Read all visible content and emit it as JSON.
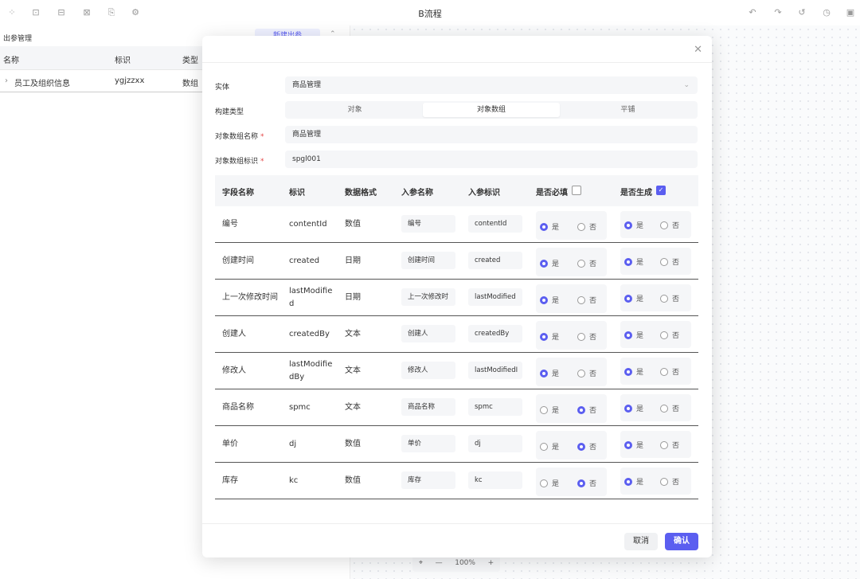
{
  "app": {
    "title": "B流程"
  },
  "toolbar_left_icons": [
    "grid-icon",
    "variable-icon",
    "code-icon",
    "bracket-x-icon",
    "copy-doc-icon",
    "gear-icon"
  ],
  "toolbar_right_icons": [
    "undo-arrow-icon",
    "redo-arrow-icon",
    "rotate-back-icon",
    "history-icon",
    "save-icon"
  ],
  "left_panel": {
    "title": "出参管理",
    "new_button": "新建出参",
    "columns": [
      "名称",
      "标识",
      "类型"
    ],
    "rows": [
      {
        "name": "员工及组织信息",
        "id": "ygjzzxx",
        "type": "数组"
      }
    ]
  },
  "zoom": {
    "minus": "—",
    "value": "100%",
    "plus": "+"
  },
  "modal": {
    "entity_label": "实体",
    "entity_value": "商品管理",
    "build_type_label": "构建类型",
    "build_types": [
      "对象",
      "对象数组",
      "平铺"
    ],
    "active_build_type": "对象数组",
    "array_name_label": "对象数组名称",
    "array_name_value": "商品管理",
    "array_id_label": "对象数组标识",
    "array_id_value": "spgl001",
    "required_mark": "*",
    "table": {
      "headers": [
        "字段名称",
        "标识",
        "数据格式",
        "入参名称",
        "入参标识",
        "是否必填",
        "是否生成"
      ],
      "rows": [
        {
          "field": "编号",
          "id": "contentId",
          "format": "数值",
          "param_name": "编号",
          "param_id": "contentId",
          "required": "是",
          "generate": "是"
        },
        {
          "field": "创建时间",
          "id": "created",
          "format": "日期",
          "param_name": "创建时间",
          "param_id": "created",
          "required": "是",
          "generate": "是"
        },
        {
          "field": "上一次修改时间",
          "id": "lastModified",
          "format": "日期",
          "param_name": "上一次修改时",
          "param_id": "lastModified",
          "required": "是",
          "generate": "是"
        },
        {
          "field": "创建人",
          "id": "createdBy",
          "format": "文本",
          "param_name": "创建人",
          "param_id": "createdBy",
          "required": "是",
          "generate": "是"
        },
        {
          "field": "修改人",
          "id": "lastModifiedBy",
          "format": "文本",
          "param_name": "修改人",
          "param_id": "lastModifiedI",
          "required": "是",
          "generate": "是"
        },
        {
          "field": "商品名称",
          "id": "spmc",
          "format": "文本",
          "param_name": "商品名称",
          "param_id": "spmc",
          "required": "否",
          "generate": "是"
        },
        {
          "field": "单价",
          "id": "dj",
          "format": "数值",
          "param_name": "单价",
          "param_id": "dj",
          "required": "否",
          "generate": "是"
        },
        {
          "field": "库存",
          "id": "kc",
          "format": "数值",
          "param_name": "库存",
          "param_id": "kc",
          "required": "否",
          "generate": "是"
        }
      ],
      "yes": "是",
      "no": "否"
    },
    "cancel": "取消",
    "confirm": "确认"
  },
  "colors": {
    "accent": "#5b5ef0",
    "required": "#e54848"
  }
}
